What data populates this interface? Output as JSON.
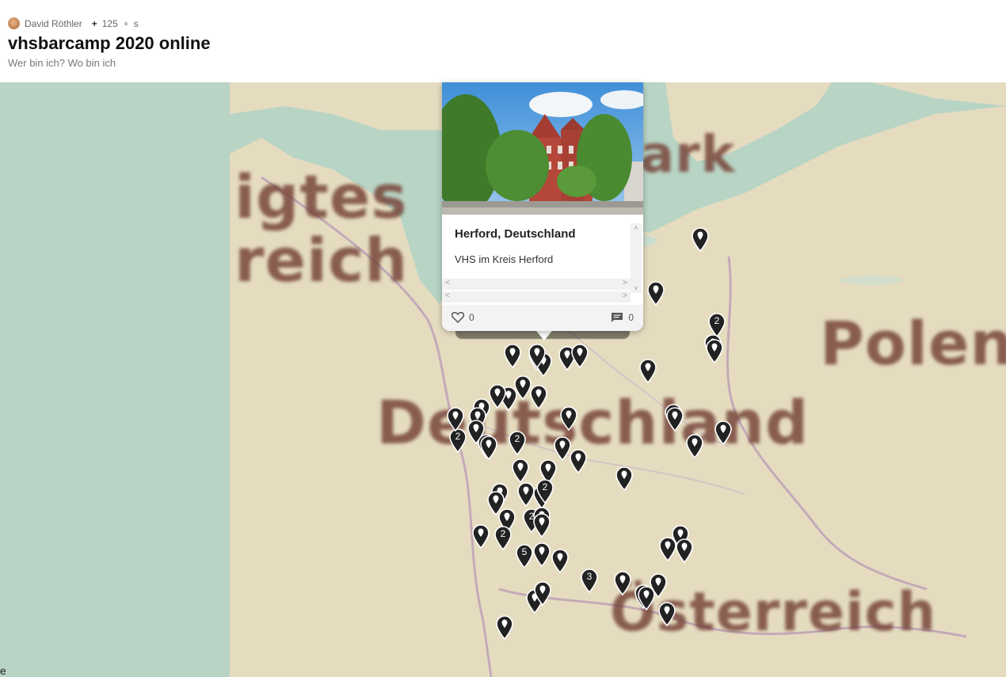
{
  "header": {
    "author": "David Röthler",
    "likes": "125",
    "extra": "s",
    "title": "vhsbarcamp 2020 online",
    "subtitle": "Wer bin ich? Wo bin ich"
  },
  "map": {
    "labels": [
      "igtes",
      "reich",
      "ark",
      "Polen",
      "Deutschland",
      "Österreich"
    ],
    "attribution": "e",
    "colors": {
      "water": "#b8d4c5",
      "land": "#e5dcc0",
      "border": "#b9a0b8",
      "marker": "#222222"
    },
    "markers": [
      {
        "count": "",
        "icon": "marker-icon"
      },
      {
        "count": "",
        "icon": "marker-icon"
      },
      {
        "count": "2",
        "icon": "marker-icon"
      },
      {
        "count": "",
        "icon": "marker-icon"
      },
      {
        "count": "",
        "icon": "marker-icon"
      },
      {
        "count": "",
        "icon": "marker-icon"
      },
      {
        "count": "",
        "icon": "marker-icon"
      },
      {
        "count": "",
        "icon": "marker-icon"
      },
      {
        "count": "",
        "icon": "marker-icon"
      },
      {
        "count": "",
        "icon": "marker-icon"
      },
      {
        "count": "",
        "icon": "marker-icon"
      },
      {
        "count": "",
        "icon": "marker-icon"
      },
      {
        "count": "",
        "icon": "marker-icon"
      },
      {
        "count": "",
        "icon": "marker-icon"
      },
      {
        "count": "",
        "icon": "marker-icon"
      },
      {
        "count": "",
        "icon": "marker-icon"
      },
      {
        "count": "",
        "icon": "marker-icon"
      },
      {
        "count": "",
        "icon": "marker-icon"
      },
      {
        "count": "2",
        "icon": "marker-icon"
      },
      {
        "count": "",
        "icon": "marker-icon"
      },
      {
        "count": "2",
        "icon": "marker-icon"
      },
      {
        "count": "",
        "icon": "marker-icon"
      },
      {
        "count": "",
        "icon": "marker-icon"
      },
      {
        "count": "",
        "icon": "marker-icon"
      },
      {
        "count": "2",
        "icon": "marker-icon"
      },
      {
        "count": "",
        "icon": "marker-icon"
      },
      {
        "count": "",
        "icon": "marker-icon"
      },
      {
        "count": "",
        "icon": "marker-icon"
      },
      {
        "count": "",
        "icon": "marker-icon"
      },
      {
        "count": "",
        "icon": "marker-icon"
      },
      {
        "count": "",
        "icon": "marker-icon"
      },
      {
        "count": "",
        "icon": "marker-icon"
      },
      {
        "count": "",
        "icon": "marker-icon"
      },
      {
        "count": "",
        "icon": "marker-icon"
      },
      {
        "count": "",
        "icon": "marker-icon"
      },
      {
        "count": "",
        "icon": "marker-icon"
      },
      {
        "count": "",
        "icon": "marker-icon"
      },
      {
        "count": "",
        "icon": "marker-icon"
      },
      {
        "count": "2",
        "icon": "marker-icon"
      },
      {
        "count": "",
        "icon": "marker-icon"
      },
      {
        "count": "2",
        "icon": "marker-icon"
      },
      {
        "count": "",
        "icon": "marker-icon"
      },
      {
        "count": "",
        "icon": "marker-icon"
      },
      {
        "count": "",
        "icon": "marker-icon"
      },
      {
        "count": "2",
        "icon": "marker-icon"
      },
      {
        "count": "5",
        "icon": "marker-icon"
      },
      {
        "count": "",
        "icon": "marker-icon"
      },
      {
        "count": "",
        "icon": "marker-icon"
      },
      {
        "count": "3",
        "icon": "marker-icon"
      },
      {
        "count": "",
        "icon": "marker-icon"
      },
      {
        "count": "",
        "icon": "marker-icon"
      },
      {
        "count": "",
        "icon": "marker-icon"
      },
      {
        "count": "",
        "icon": "marker-icon"
      },
      {
        "count": "",
        "icon": "marker-icon"
      },
      {
        "count": "",
        "icon": "marker-icon"
      },
      {
        "count": "",
        "icon": "marker-icon"
      },
      {
        "count": "",
        "icon": "marker-icon"
      },
      {
        "count": "",
        "icon": "marker-icon"
      },
      {
        "count": "",
        "icon": "marker-icon"
      },
      {
        "count": "",
        "icon": "marker-icon"
      }
    ]
  },
  "popup": {
    "title": "Herford, Deutschland",
    "description": "VHS im Kreis Herford",
    "likes": "0",
    "comments": "0",
    "like_icon": "heart-icon",
    "comment_icon": "comment-icon"
  }
}
